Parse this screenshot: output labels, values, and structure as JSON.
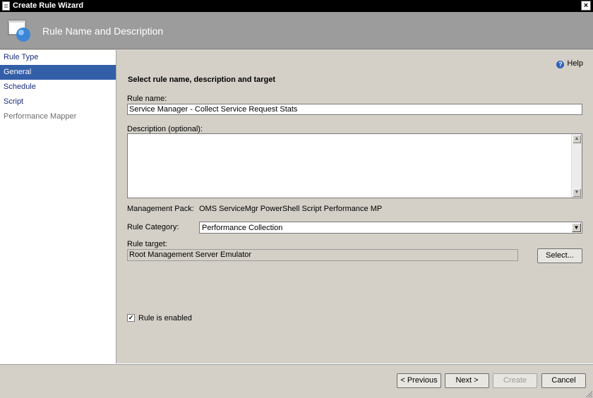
{
  "window": {
    "title": "Create Rule Wizard",
    "close_label": "×"
  },
  "banner": {
    "title": "Rule Name and Description"
  },
  "nav": {
    "items": [
      {
        "label": "Rule Type"
      },
      {
        "label": "General"
      },
      {
        "label": "Schedule"
      },
      {
        "label": "Script"
      },
      {
        "label": "Performance Mapper"
      }
    ],
    "active_index": 1
  },
  "help": {
    "label": "Help",
    "icon": "?"
  },
  "form": {
    "heading": "Select rule name, description and target",
    "rule_name_label": "Rule name:",
    "rule_name_value": "Service Manager - Collect Service Request Stats",
    "description_label": "Description (optional):",
    "description_value": "",
    "management_pack_label": "Management Pack:",
    "management_pack_value": "OMS ServiceMgr PowerShell Script Performance MP",
    "rule_category_label": "Rule Category:",
    "rule_category_value": "Performance Collection",
    "rule_target_label": "Rule target:",
    "rule_target_value": "Root Management Server Emulator",
    "select_button": "Select...",
    "enabled_label": "Rule is enabled",
    "enabled": true,
    "check_mark": "✓"
  },
  "footer": {
    "previous": "< Previous",
    "next": "Next >",
    "create": "Create",
    "cancel": "Cancel"
  },
  "scroll": {
    "up": "▲",
    "down": "▼",
    "dropdown": "▼"
  }
}
